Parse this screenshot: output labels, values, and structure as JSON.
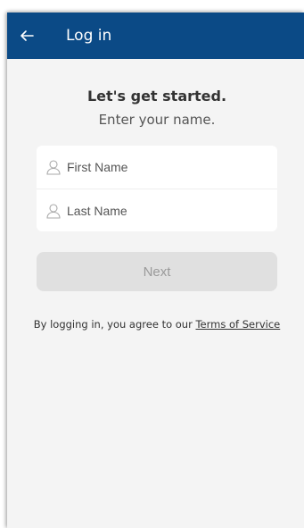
{
  "header": {
    "title": "Log in",
    "back_icon": "arrow-left-icon",
    "background": "#0b4a86"
  },
  "intro": {
    "heading": "Let's get started.",
    "subheading": "Enter your name."
  },
  "form": {
    "first_name": {
      "placeholder": "First Name",
      "value": "",
      "icon": "user-icon"
    },
    "last_name": {
      "placeholder": "Last Name",
      "value": "",
      "icon": "user-icon"
    },
    "next_label": "Next"
  },
  "footer": {
    "terms_prefix": "By logging in, you agree to our ",
    "terms_link": "Terms of Service"
  }
}
